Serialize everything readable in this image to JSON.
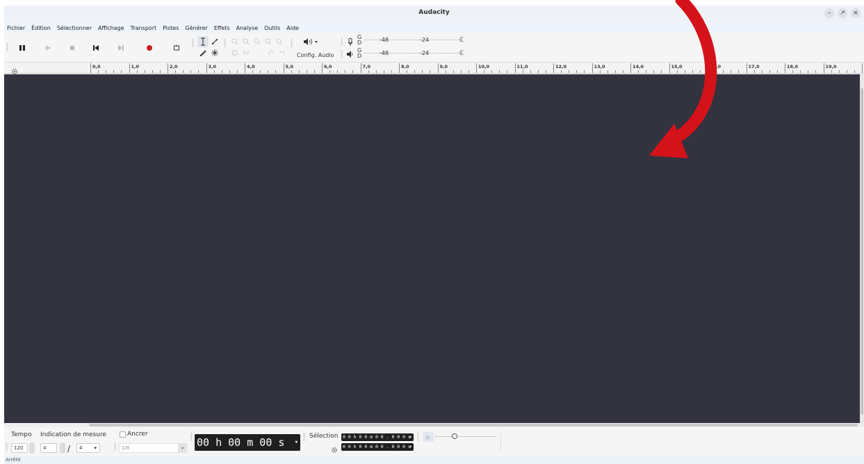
{
  "window": {
    "title": "Audacity",
    "min_label": "–",
    "max_label": "↗",
    "close_label": "×"
  },
  "menu": [
    "Fichier",
    "Édition",
    "Sélectionner",
    "Affichage",
    "Transport",
    "Pistes",
    "Générer",
    "Effets",
    "Analyse",
    "Outils",
    "Aide"
  ],
  "toolbar": {
    "audio_setup_label": "Config. Audio",
    "meter_rec": {
      "channel_top": "G",
      "channel_bottom": "D",
      "mark1": "-48",
      "mark2": "-24"
    },
    "meter_play": {
      "channel_top": "G",
      "channel_bottom": "D",
      "mark1": "-48",
      "mark2": "-24"
    },
    "icons": [
      "pause-icon",
      "play-icon",
      "stop-icon",
      "skip-start-icon",
      "skip-end-icon",
      "record-icon",
      "loop-icon",
      "selection-tool-icon",
      "envelope-tool-icon",
      "draw-tool-icon",
      "multi-tool-icon",
      "zoom-in-icon",
      "zoom-out-icon",
      "fit-selection-icon",
      "fit-project-icon",
      "zoom-toggle-icon",
      "trim-icon",
      "silence-icon",
      "undo-icon",
      "redo-icon",
      "audio-setup-icon",
      "microphone-icon",
      "speaker-icon"
    ]
  },
  "ruler": {
    "labels": [
      "0,0",
      "1,0",
      "2,0",
      "3,0",
      "4,0",
      "5,0",
      "6,0",
      "7,0",
      "8,0",
      "9,0",
      "10,0",
      "11,0",
      "12,0",
      "13,0",
      "14,0",
      "15,0",
      "16,0",
      "17,0",
      "18,0",
      "19,0",
      "20,0"
    ]
  },
  "bottom": {
    "tempo_label": "Tempo",
    "time_sig_label": "Indication de mesure",
    "snap_label": "Ancrer",
    "tempo_value": "120",
    "ts_upper": "4",
    "ts_slash": "/",
    "ts_lower": "4",
    "snap_value": "1/8",
    "time_display": "00 h 00 m 00 s",
    "selection_label": "Sélection",
    "sel_start": "0 0 h 0 0 m 0 0 . 0 0 0 s",
    "sel_end": "0 0 h 0 0 m 0 0 . 0 0 0 s"
  },
  "status": "Arrêté",
  "colors": {
    "track_bg": "#33323f",
    "arrow": "#d4121a",
    "record": "#c41e1e"
  }
}
